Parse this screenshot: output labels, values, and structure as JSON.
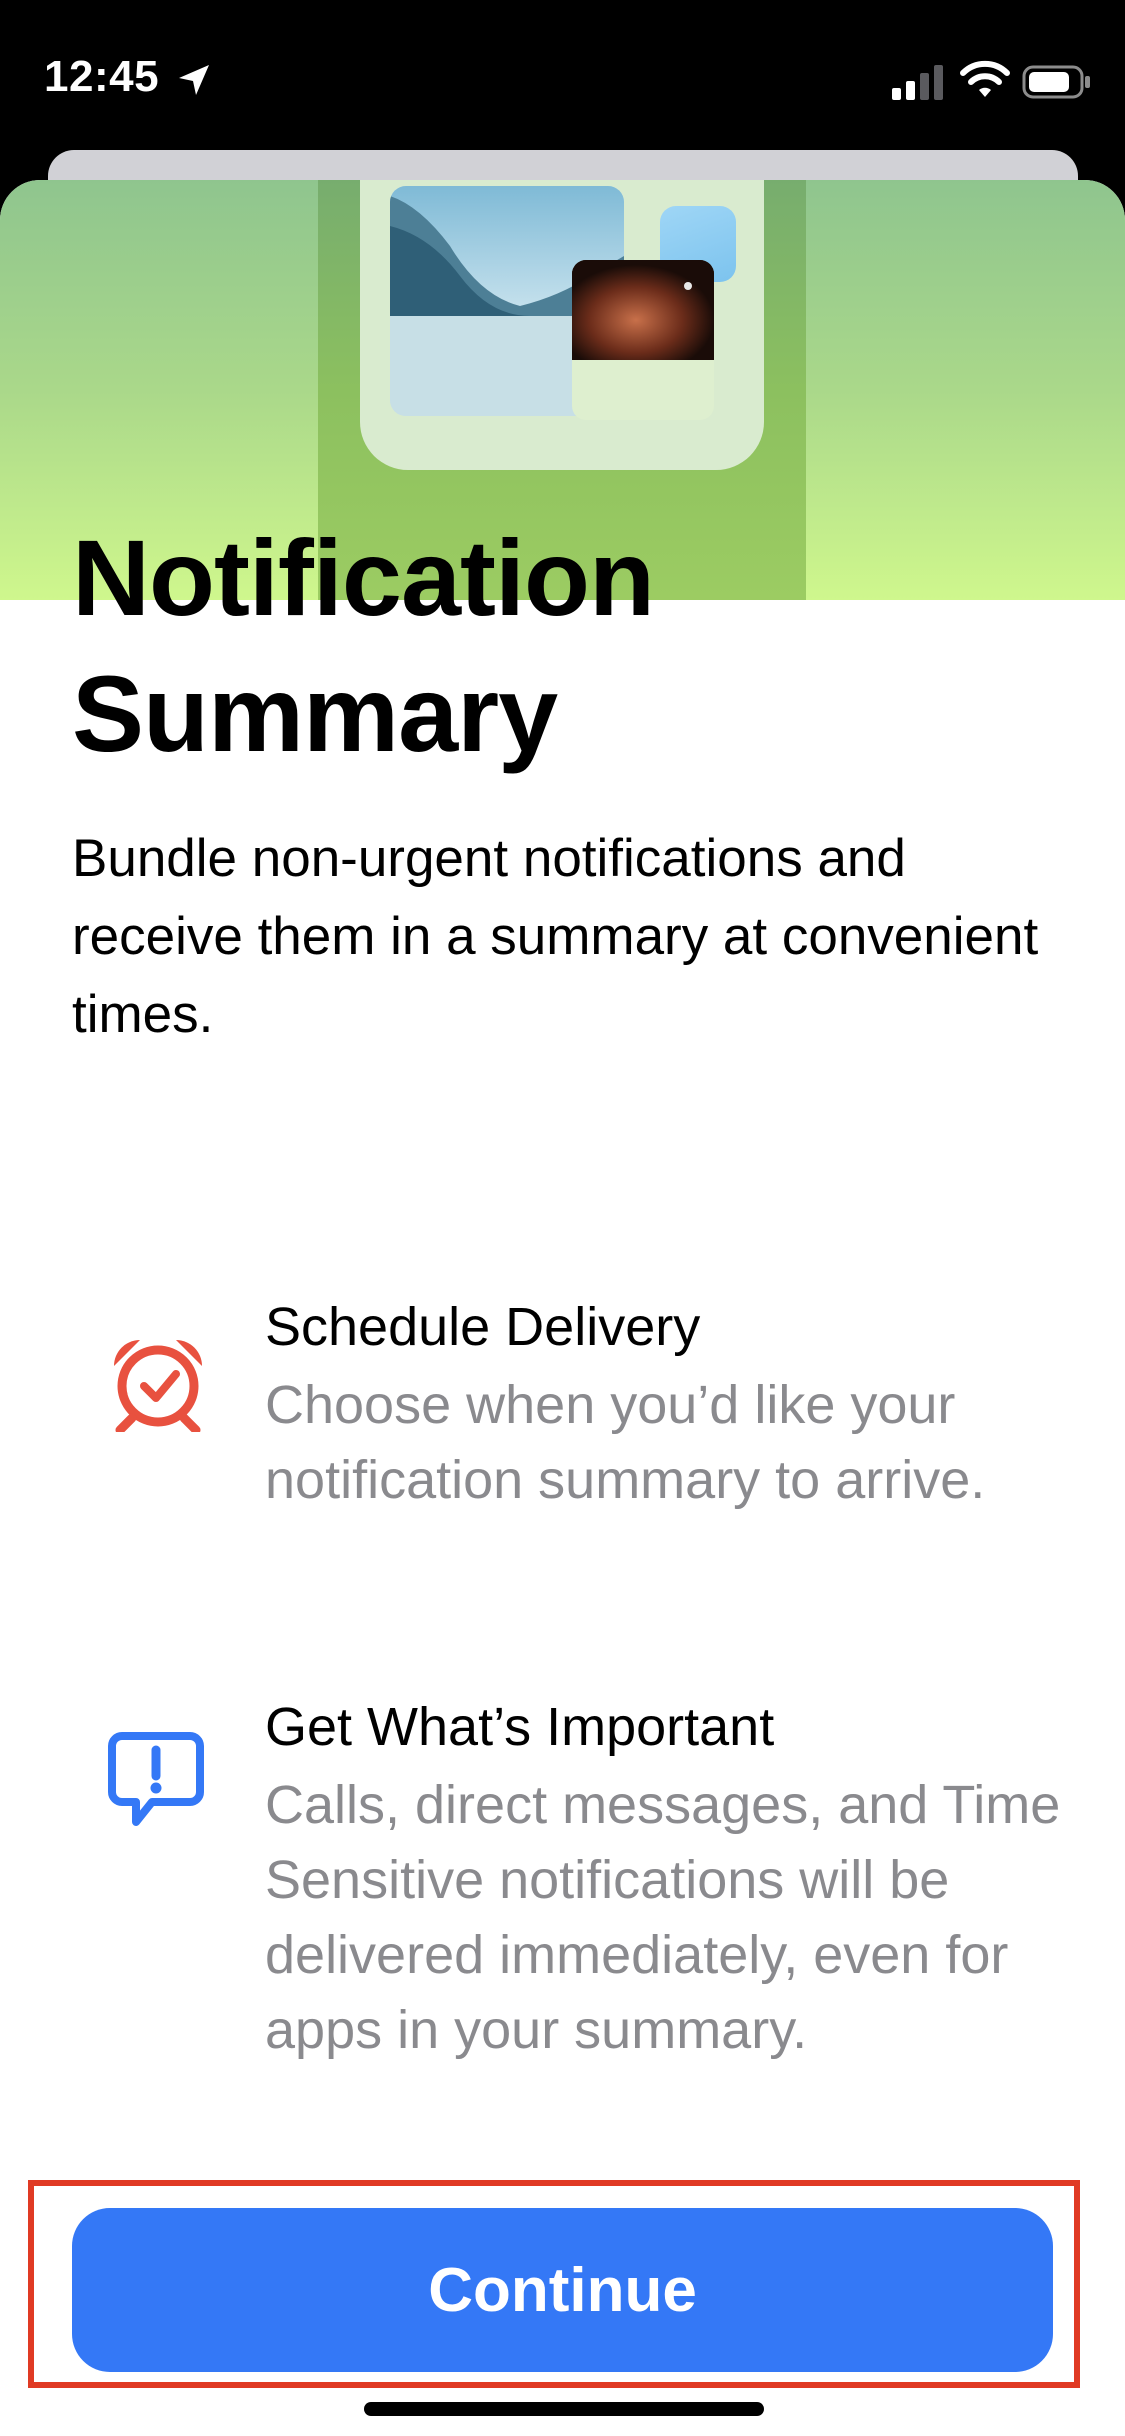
{
  "status_bar": {
    "time": "12:45",
    "icons": [
      "location-arrow-icon",
      "cellular-signal-icon",
      "wifi-icon",
      "battery-icon"
    ]
  },
  "hero": {
    "illustration": "notification-summary-illustration"
  },
  "content": {
    "title_line1": "Notification",
    "title_line2": "Summary",
    "description": "Bundle non-urgent notifications and receive them in a summary at convenient times.",
    "features": [
      {
        "icon": "alarm-clock-icon",
        "icon_color": "#e8513f",
        "title": "Schedule Delivery",
        "description": "Choose when you’d like your notification summary to arrive."
      },
      {
        "icon": "exclamation-bubble-icon",
        "icon_color": "#3478f6",
        "title": "Get What’s Important",
        "description": "Calls, direct messages, and Time Sensitive notifications will be delivered immediately, even for apps in your summary."
      }
    ]
  },
  "footer": {
    "continue_label": "Continue",
    "highlight_color": "#e03a24",
    "button_color": "#3478f6"
  }
}
